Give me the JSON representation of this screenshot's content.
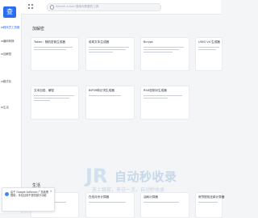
{
  "sidebar": {
    "logo": "查",
    "items": [
      "程序员工具箱",
      "编码转换",
      "加解密",
      "格式化",
      "生活"
    ]
  },
  "topbar": {
    "search_placeholder": "Search a tool 搜索你想要的工具"
  },
  "sections": [
    {
      "title": "加解密",
      "cards": [
        {
          "title": "Token：随机密钥生成器"
        },
        {
          "title": "哈希文本生成器"
        },
        {
          "title": "Bcrypt"
        },
        {
          "title": "UUID V4 生成器"
        },
        {
          "title": "文本加密、解密"
        },
        {
          "title": "BIP39助记词生成器"
        },
        {
          "title": "RSA密钥对生成器"
        }
      ]
    },
    {
      "title": "生活",
      "cards": [
        {
          "title": "个税计算器"
        },
        {
          "title": "在线月份计算器"
        },
        {
          "title": "油耗计算器"
        },
        {
          "title": "房贷提前还款计算器"
        }
      ]
    }
  ],
  "watermark": {
    "logo_text": "JR",
    "main": "自动秒收录",
    "sub": "放上链接，来访一次，自动秒收录"
  },
  "notice": {
    "text": "由于 Google AdSense 广告政策限制，本站目前不提供部分功能"
  },
  "colors": {
    "accent": "#2b6df0",
    "background": "#f4f5f7"
  }
}
